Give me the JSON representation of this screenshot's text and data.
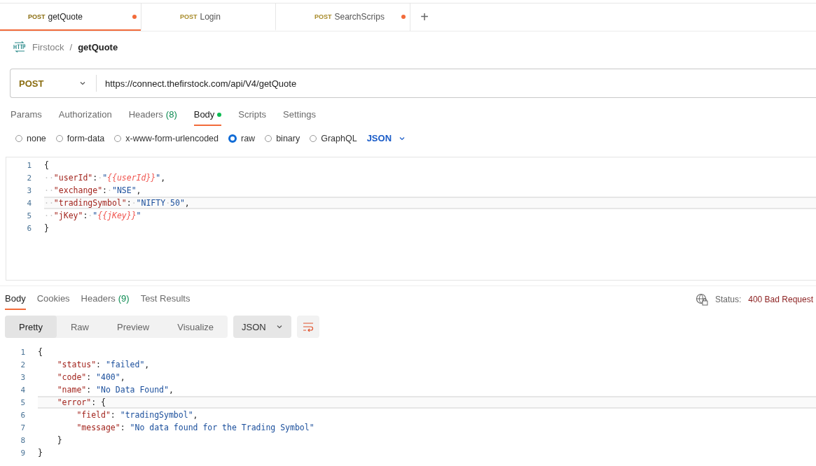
{
  "tabs": [
    {
      "method": "POST",
      "name": "getQuote",
      "unsaved": true,
      "selected": true
    },
    {
      "method": "POST",
      "name": "Login",
      "unsaved": false,
      "selected": false
    },
    {
      "method": "POST",
      "name": "SearchScrips",
      "unsaved": true,
      "selected": false
    }
  ],
  "new_tab": "+",
  "breadcrumb": {
    "collection": "Firstock",
    "separator": "/",
    "request": "getQuote"
  },
  "url_bar": {
    "method": "POST",
    "url": "https://connect.thefirstock.com/api/V4/getQuote"
  },
  "request_tabs": [
    {
      "label": "Params",
      "selected": false
    },
    {
      "label": "Authorization",
      "selected": false
    },
    {
      "label": "Headers",
      "count": "(8)",
      "selected": false
    },
    {
      "label": "Body",
      "dot": true,
      "selected": true
    },
    {
      "label": "Scripts",
      "selected": false
    },
    {
      "label": "Settings",
      "selected": false
    }
  ],
  "body_types": [
    {
      "label": "none",
      "selected": false
    },
    {
      "label": "form-data",
      "selected": false
    },
    {
      "label": "x-www-form-urlencoded",
      "selected": false
    },
    {
      "label": "raw",
      "selected": true
    },
    {
      "label": "binary",
      "selected": false
    },
    {
      "label": "GraphQL",
      "selected": false
    }
  ],
  "raw_format": "JSON",
  "request_body": [
    {
      "number": "1",
      "current": false,
      "tokens": [
        {
          "kind": "punct",
          "text": "{"
        }
      ]
    },
    {
      "number": "2",
      "current": false,
      "tokens": [
        {
          "kind": "ws",
          "text": "··"
        },
        {
          "kind": "key",
          "text": "\"userId\""
        },
        {
          "kind": "punct",
          "text": ":"
        },
        {
          "kind": "ws",
          "text": "·"
        },
        {
          "kind": "str",
          "text": "\""
        },
        {
          "kind": "var",
          "text": "{{userId}}"
        },
        {
          "kind": "str",
          "text": "\""
        },
        {
          "kind": "punct",
          "text": ","
        }
      ]
    },
    {
      "number": "3",
      "current": false,
      "tokens": [
        {
          "kind": "ws",
          "text": "··"
        },
        {
          "kind": "key",
          "text": "\"exchange\""
        },
        {
          "kind": "punct",
          "text": ":"
        },
        {
          "kind": "ws",
          "text": "·"
        },
        {
          "kind": "str",
          "text": "\"NSE\""
        },
        {
          "kind": "punct",
          "text": ","
        }
      ]
    },
    {
      "number": "4",
      "current": true,
      "tokens": [
        {
          "kind": "ws",
          "text": "··"
        },
        {
          "kind": "key",
          "text": "\"tradingSymbol\""
        },
        {
          "kind": "punct",
          "text": ":"
        },
        {
          "kind": "ws",
          "text": "·"
        },
        {
          "kind": "str",
          "text": "\"NIFTY"
        },
        {
          "kind": "ws",
          "text": "·"
        },
        {
          "kind": "str",
          "text": "50\""
        },
        {
          "kind": "punct",
          "text": ","
        }
      ]
    },
    {
      "number": "5",
      "current": false,
      "tokens": [
        {
          "kind": "ws",
          "text": "··"
        },
        {
          "kind": "key",
          "text": "\"jKey\""
        },
        {
          "kind": "punct",
          "text": ":"
        },
        {
          "kind": "ws",
          "text": "·"
        },
        {
          "kind": "str",
          "text": "\""
        },
        {
          "kind": "var",
          "text": "{{jKey}}"
        },
        {
          "kind": "str",
          "text": "\""
        }
      ]
    },
    {
      "number": "6",
      "current": false,
      "tokens": [
        {
          "kind": "punct",
          "text": "}"
        }
      ]
    }
  ],
  "response_tabs": [
    {
      "label": "Body",
      "selected": true
    },
    {
      "label": "Cookies",
      "selected": false
    },
    {
      "label": "Headers",
      "count": "(9)",
      "selected": false
    },
    {
      "label": "Test Results",
      "selected": false
    }
  ],
  "status": {
    "label": "Status:",
    "value": "400 Bad Request"
  },
  "view_modes": [
    {
      "label": "Pretty",
      "selected": true
    },
    {
      "label": "Raw",
      "selected": false
    },
    {
      "label": "Preview",
      "selected": false
    },
    {
      "label": "Visualize",
      "selected": false
    }
  ],
  "response_format": "JSON",
  "response_body": [
    {
      "number": "1",
      "current": false,
      "tokens": [
        {
          "kind": "punct",
          "text": "{"
        }
      ],
      "children": [
        {
          "number": "2",
          "current": false,
          "tokens": [
            {
              "kind": "key",
              "text": "\"status\""
            },
            {
              "kind": "punct",
              "text": ": "
            },
            {
              "kind": "str",
              "text": "\"failed\""
            },
            {
              "kind": "punct",
              "text": ","
            }
          ]
        },
        {
          "number": "3",
          "current": false,
          "tokens": [
            {
              "kind": "key",
              "text": "\"code\""
            },
            {
              "kind": "punct",
              "text": ": "
            },
            {
              "kind": "str",
              "text": "\"400\""
            },
            {
              "kind": "punct",
              "text": ","
            }
          ]
        },
        {
          "number": "4",
          "current": false,
          "tokens": [
            {
              "kind": "key",
              "text": "\"name\""
            },
            {
              "kind": "punct",
              "text": ": "
            },
            {
              "kind": "str",
              "text": "\"No Data Found\""
            },
            {
              "kind": "punct",
              "text": ","
            }
          ]
        },
        {
          "number": "5",
          "current": true,
          "tokens": [
            {
              "kind": "key",
              "text": "\"error\""
            },
            {
              "kind": "punct",
              "text": ": {"
            }
          ],
          "children": [
            {
              "number": "6",
              "current": false,
              "tokens": [
                {
                  "kind": "key",
                  "text": "\"field\""
                },
                {
                  "kind": "punct",
                  "text": ": "
                },
                {
                  "kind": "str",
                  "text": "\"tradingSymbol\""
                },
                {
                  "kind": "punct",
                  "text": ","
                }
              ]
            },
            {
              "number": "7",
              "current": false,
              "tokens": [
                {
                  "kind": "key",
                  "text": "\"message\""
                },
                {
                  "kind": "punct",
                  "text": ": "
                },
                {
                  "kind": "str",
                  "text": "\"No data found for the Trading Symbol\""
                }
              ]
            }
          ]
        },
        {
          "number": "8",
          "current": false,
          "tokens": [
            {
              "kind": "punct",
              "text": "}"
            }
          ]
        }
      ]
    },
    {
      "number": "9",
      "current": false,
      "tokens": [
        {
          "kind": "punct",
          "text": "}"
        }
      ]
    }
  ]
}
